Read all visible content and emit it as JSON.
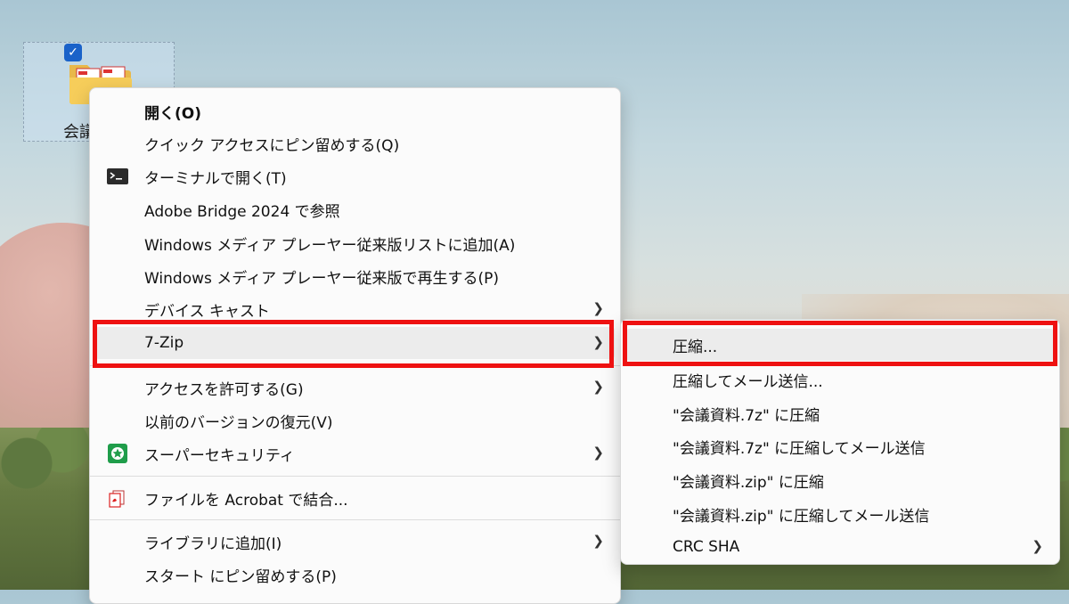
{
  "desktop": {
    "icon_label": "会議",
    "icon_checked": true
  },
  "context_menu": {
    "items": [
      {
        "label": "開く(O)",
        "bold": true
      },
      {
        "label": "クイック アクセスにピン留めする(Q)"
      },
      {
        "label": "ターミナルで開く(T)",
        "icon": "terminal-icon"
      },
      {
        "label": "Adobe Bridge 2024 で参照"
      },
      {
        "label": "Windows メディア プレーヤー従来版リストに追加(A)"
      },
      {
        "label": "Windows メディア プレーヤー従来版で再生する(P)"
      },
      {
        "label": "デバイス キャスト",
        "has_submenu": true
      },
      {
        "label": "7-Zip",
        "has_submenu": true,
        "highlighted": true
      },
      {
        "label": "アクセスを許可する(G)",
        "has_submenu": true
      },
      {
        "label": "以前のバージョンの復元(V)"
      },
      {
        "label": "スーパーセキュリティ",
        "has_submenu": true,
        "icon": "security-shield-icon"
      },
      {
        "label": "ファイルを Acrobat で結合...",
        "icon": "acrobat-icon"
      },
      {
        "label": "ライブラリに追加(I)",
        "has_submenu": true
      },
      {
        "label": "スタート にピン留めする(P)"
      }
    ]
  },
  "zip_submenu": {
    "items": [
      {
        "label": "圧縮...",
        "highlighted": true
      },
      {
        "label": "圧縮してメール送信..."
      },
      {
        "label": "\"会議資料.7z\" に圧縮"
      },
      {
        "label": "\"会議資料.7z\" に圧縮してメール送信"
      },
      {
        "label": "\"会議資料.zip\" に圧縮"
      },
      {
        "label": "\"会議資料.zip\" に圧縮してメール送信"
      },
      {
        "label": "CRC SHA",
        "has_submenu": true
      }
    ]
  },
  "colors": {
    "highlight_border": "#ee1111",
    "menu_background": "#fbfbfb",
    "hover_background": "#ececec",
    "checkbox": "#1a62c9"
  }
}
